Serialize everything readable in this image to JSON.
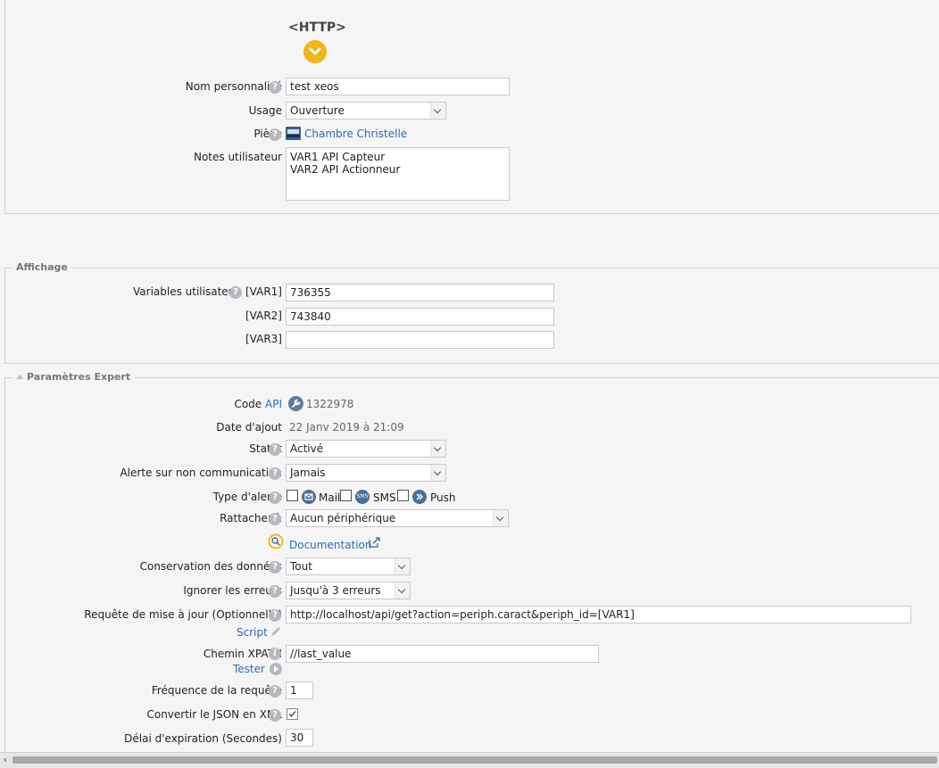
{
  "header": {
    "title": "<HTTP>"
  },
  "general": {
    "name_label": "Nom personnalisé",
    "name_value": "test xeos",
    "usage_label": "Usage",
    "usage_value": "Ouverture",
    "room_label": "Pièce",
    "room_value": "Chambre Christelle",
    "notes_label": "Notes utilisateur",
    "notes_line1": "VAR1 API Capteur",
    "notes_line2": "VAR2 API Actionneur"
  },
  "display": {
    "legend": "Affichage",
    "vars_label": "Variables utilisateur",
    "var1_label": "[VAR1]",
    "var1_value": "736355",
    "var2_label": "[VAR2]",
    "var2_value": "743840",
    "var3_label": "[VAR3]",
    "var3_value": ""
  },
  "expert": {
    "legend": "Paramètres Expert",
    "code_label": "Code",
    "api_link": "API",
    "code_value": "1322978",
    "date_label": "Date d'ajout",
    "date_value": "22 Janv 2019 à 21:09",
    "status_label": "Statut",
    "status_value": "Activé",
    "alert_label": "Alerte sur non communication",
    "alert_value": "Jamais",
    "alert_type_label": "Type d'alerte",
    "mail": "Mail",
    "sms": "SMS",
    "sms_icon_text": "SMS",
    "push": "Push",
    "attach_label": "Rattacher à",
    "attach_value": "Aucun périphérique",
    "doc_link": "Documentation",
    "retention_label": "Conservation des données",
    "retention_value": "Tout",
    "ignore_label": "Ignorer les erreurs",
    "ignore_value": "Jusqu'à 3 erreurs",
    "request_label": "Requête de mise à jour (Optionnelle)",
    "request_value": "http://localhost/api/get?action=periph.caract&periph_id=[VAR1]",
    "script_link": "Script",
    "xpath_label": "Chemin XPATH",
    "xpath_value": "//last_value",
    "tester_link": "Tester",
    "freq_label": "Fréquence de la requête",
    "freq_value": "1",
    "json_label": "Convertir le JSON en XML",
    "timeout_label": "Délai d'expiration (Secondes)",
    "timeout_value": "30"
  },
  "icons": {
    "help": "help-icon",
    "expand": "chevron-down-icon",
    "room": "room-icon",
    "wrench": "wrench-icon",
    "pencil": "pencil-icon",
    "play": "play-icon",
    "info": "info-icon",
    "external": "external-link-icon"
  },
  "colors": {
    "accent": "#f2b51c",
    "link": "#2f6ab0",
    "background": "#f5f5f5"
  }
}
